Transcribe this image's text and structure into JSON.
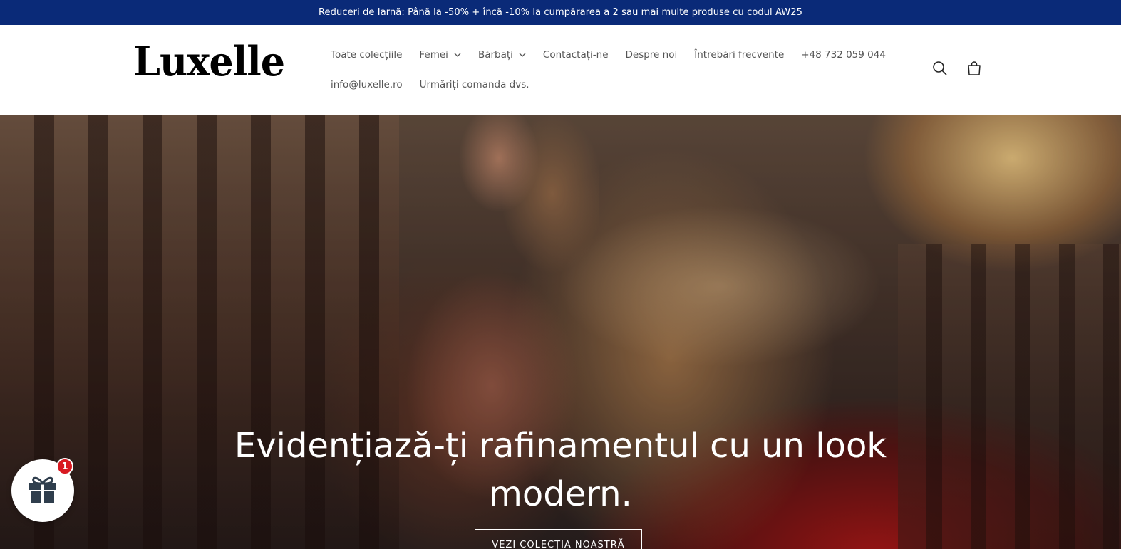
{
  "announcement": {
    "text": "Reduceri de Iarnă: Până la -50% + încă -10% la cumpărarea a 2 sau mai multe produse cu codul AW25"
  },
  "header": {
    "logo": "Luxelle",
    "nav_row1": [
      {
        "label": "Toate colecțiile",
        "dropdown": false
      },
      {
        "label": "Femei",
        "dropdown": true
      },
      {
        "label": "Bărbați",
        "dropdown": true
      },
      {
        "label": "Contactați-ne",
        "dropdown": false
      },
      {
        "label": "Despre noi",
        "dropdown": false
      },
      {
        "label": "Întrebări frecvente",
        "dropdown": false
      },
      {
        "label": "+48 732 059 044",
        "dropdown": false
      }
    ],
    "nav_row2": [
      {
        "label": "info@luxelle.ro",
        "dropdown": false
      },
      {
        "label": "Urmăriți comanda dvs.",
        "dropdown": false
      }
    ],
    "icons": [
      "search-icon",
      "cart-icon"
    ]
  },
  "hero": {
    "title": "Evidențiază-ți rafinamentul cu un look modern.",
    "button_label": "VEZI COLECȚIA NOASTRĂ"
  },
  "gift_widget": {
    "badge_count": "1",
    "icon": "gift-icon"
  },
  "colors": {
    "announcement_bg": "#0a2a78",
    "badge": "#d81921",
    "gift_icon": "#2f3e4d"
  }
}
